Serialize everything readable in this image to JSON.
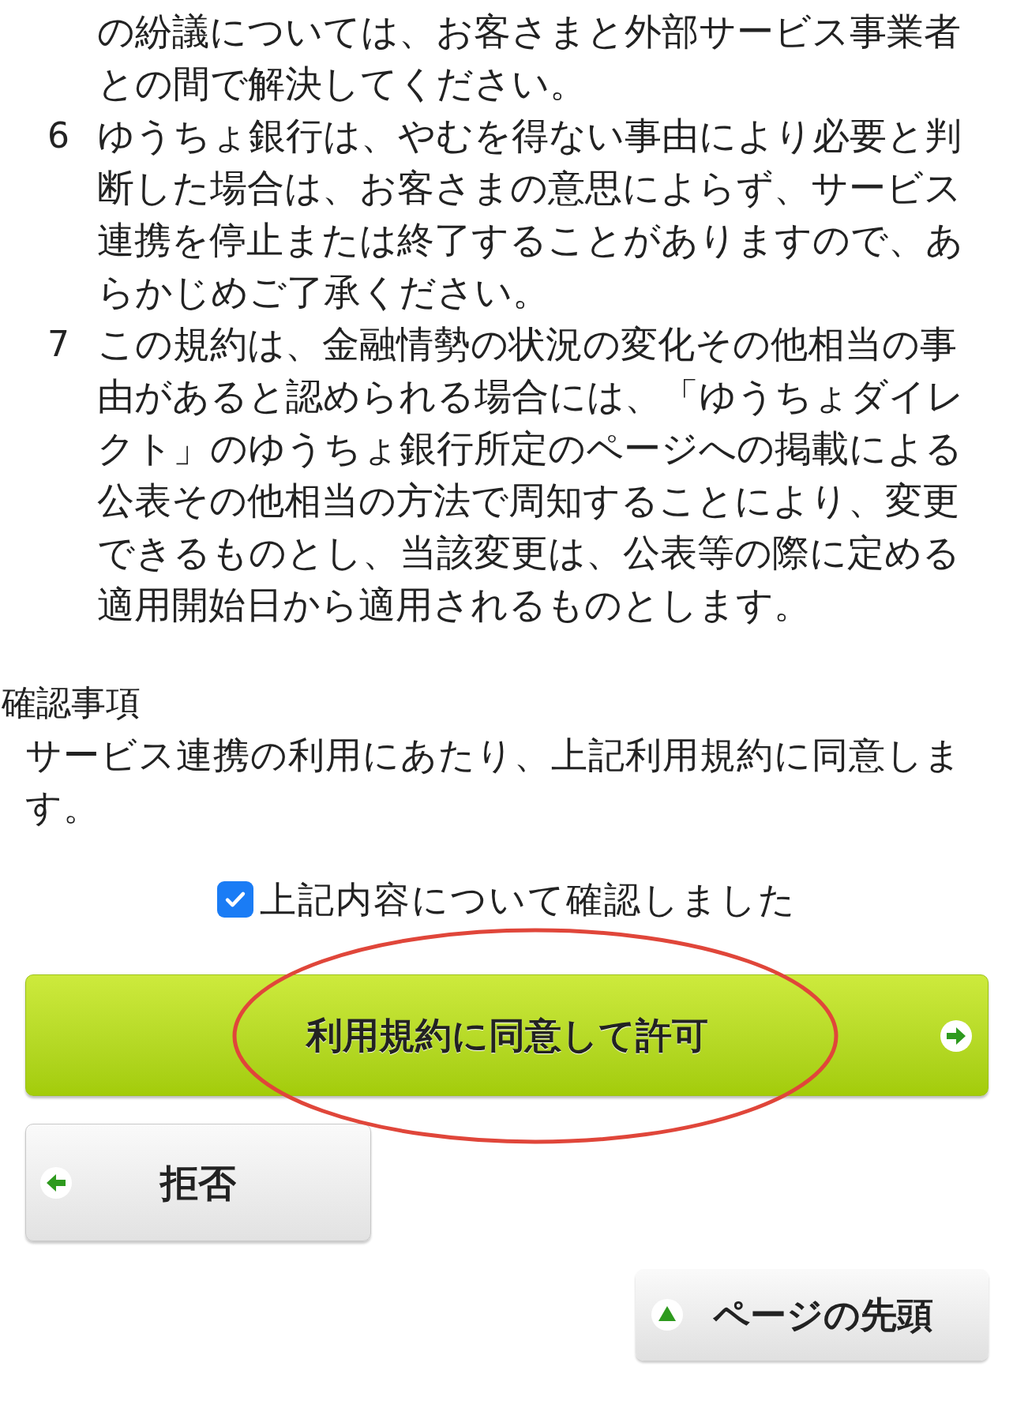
{
  "terms": [
    {
      "lines": [
        "の紛議については、お客さまと外部サービス事業者",
        "との間で解決してください。"
      ]
    },
    {
      "number": "6",
      "lines": [
        "ゆうちょ銀行は、やむを得ない事由により必要と判",
        "断した場合は、お客さまの意思によらず、サービス",
        "連携を停止または終了することがありますので、あ",
        "らかじめご了承ください。"
      ]
    },
    {
      "number": "7",
      "lines": [
        "この規約は、金融情勢の状況の変化その他相当の事",
        "由があると認められる場合には、「ゆうちょダイレ",
        "クト」のゆうちょ銀行所定のページへの掲載による",
        "公表その他相当の方法で周知することにより、変更",
        "できるものとし、当該変更は、公表等の際に定める",
        "適用開始日から適用されるものとします。"
      ]
    }
  ],
  "confirmation": {
    "heading": "確認事項",
    "lines": [
      "サービス連携の利用にあたり、上記利用規約に同意しま",
      "す。"
    ]
  },
  "checkbox": {
    "label": "上記内容について確認しました",
    "checked": true
  },
  "agree_button": {
    "label": "利用規約に同意して許可",
    "highlighted": true
  },
  "reject_button": {
    "label": "拒否"
  },
  "page_top_button": {
    "label": "ページの先頭"
  }
}
